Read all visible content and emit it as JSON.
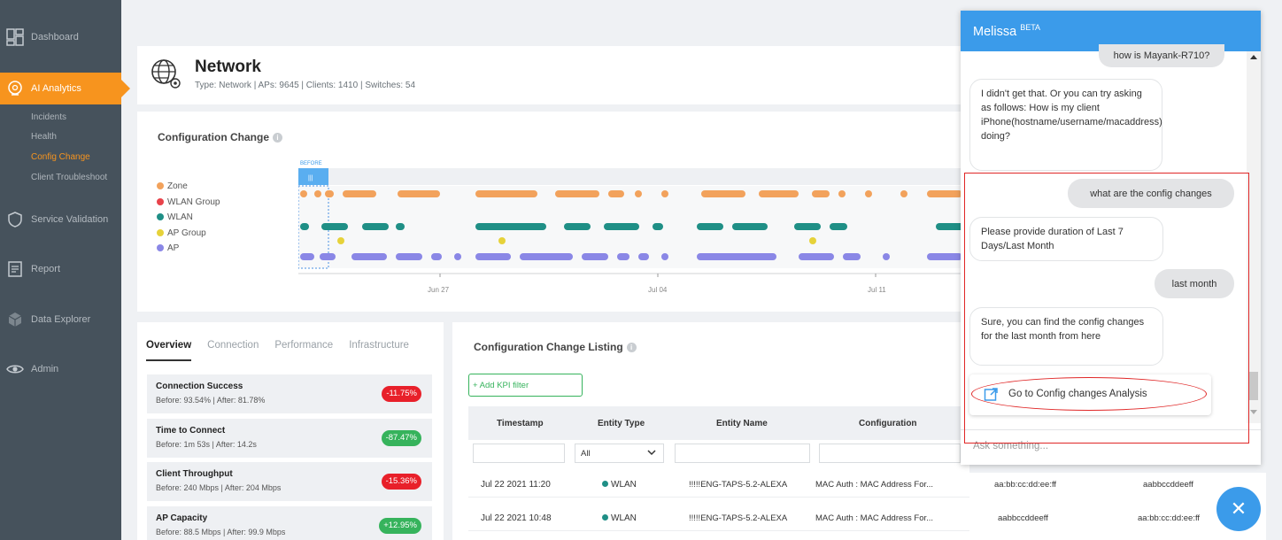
{
  "sidebar": {
    "items": [
      {
        "label": "Dashboard",
        "icon": "dashboard-icon"
      },
      {
        "label": "AI Analytics",
        "icon": "ai-analytics-icon",
        "active": true
      },
      {
        "label": "Service Validation",
        "icon": "shield-icon"
      },
      {
        "label": "Report",
        "icon": "report-icon"
      },
      {
        "label": "Data Explorer",
        "icon": "cube-icon"
      },
      {
        "label": "Admin",
        "icon": "eye-icon"
      }
    ],
    "subitems": [
      {
        "label": "Incidents"
      },
      {
        "label": "Health"
      },
      {
        "label": "Config Change",
        "active": true
      },
      {
        "label": "Client Troubleshoot"
      }
    ]
  },
  "header": {
    "title": "Network",
    "meta": "Type: Network  |  APs: 9645  |  Clients: 1410  |  Switches: 54"
  },
  "config_change": {
    "title": "Configuration Change",
    "before_label": "BEFORE",
    "handle": "|||",
    "legend": [
      {
        "label": "Zone",
        "color": "#f2a25c"
      },
      {
        "label": "WLAN Group",
        "color": "#e8434b"
      },
      {
        "label": "WLAN",
        "color": "#1f8f86"
      },
      {
        "label": "AP Group",
        "color": "#e6d23a"
      },
      {
        "label": "AP",
        "color": "#8a87e6"
      }
    ],
    "x_ticks": [
      "Jun 27",
      "Jul 04",
      "Jul 11"
    ]
  },
  "overview": {
    "tabs": [
      "Overview",
      "Connection",
      "Performance",
      "Infrastructure"
    ],
    "kpis": [
      {
        "name": "Connection Success",
        "sub": "Before: 93.54%  |  After: 81.78%",
        "badge": "-11.75%",
        "positive": false
      },
      {
        "name": "Time to Connect",
        "sub": "Before: 1m 53s  |  After: 14.2s",
        "badge": "-87.47%",
        "positive": true
      },
      {
        "name": "Client Throughput",
        "sub": "Before: 240 Mbps  |  After: 204 Mbps",
        "badge": "-15.36%",
        "positive": false
      },
      {
        "name": "AP Capacity",
        "sub": "Before: 88.5 Mbps  |  After: 99.9 Mbps",
        "badge": "+12.95%",
        "positive": true
      }
    ]
  },
  "listing": {
    "title": "Configuration Change Listing",
    "filter_button": "+ Add KPI filter",
    "columns": [
      "Timestamp",
      "Entity Type",
      "Entity Name",
      "Configuration"
    ],
    "entity_filter": "All",
    "rows": [
      {
        "timestamp": "Jul 22 2021 11:20",
        "entity_type": "WLAN",
        "entity_name": "!!!!!ENG-TAPS-5.2-ALEXA",
        "configuration": "MAC Auth : MAC Address For...",
        "before": "aa:bb:cc:dd:ee:ff",
        "after": "aabbccddeeff"
      },
      {
        "timestamp": "Jul 22 2021 10:48",
        "entity_type": "WLAN",
        "entity_name": "!!!!!ENG-TAPS-5.2-ALEXA",
        "configuration": "MAC Auth : MAC Address For...",
        "before": "aabbccddeeff",
        "after": "aa:bb:cc:dd:ee:ff"
      }
    ]
  },
  "chat": {
    "title": "Melissa",
    "badge": "BETA",
    "messages": [
      {
        "from": "user",
        "text": "how is Mayank-R710?"
      },
      {
        "from": "bot",
        "text": "I didn't get that. Or you can try asking as follows: How is my client iPhone(hostname/username/macaddress) doing?"
      },
      {
        "from": "user",
        "text": "what are the config changes"
      },
      {
        "from": "bot",
        "text": "Please provide duration of Last 7 Days/Last Month"
      },
      {
        "from": "user",
        "text": "last month"
      },
      {
        "from": "bot",
        "text": "Sure, you can find the config changes for the last month from here"
      }
    ],
    "action_link": "Go to Config changes Analysis",
    "input_placeholder": "Ask something..."
  },
  "fab_symbol": "✕"
}
